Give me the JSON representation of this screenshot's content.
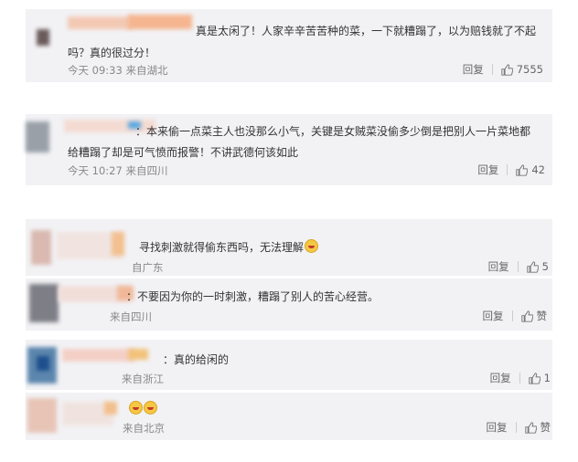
{
  "comments": [
    {
      "text_line1": "真是太闲了！人家辛辛苦苦种的菜，一下就糟蹋了，以为赔钱就了不起",
      "text_line2": "吗？真的很过分！",
      "meta": "今天 09:33 来自湖北",
      "reply": "回复",
      "likes": "7555"
    },
    {
      "text_line1": "：本来偷一点菜主人也没那么小气，关键是女贼菜没偷多少倒是把别人一片菜地都",
      "text_line2": "给糟蹋了却是可气愤而报警！不讲武德何该如此",
      "meta": "今天 10:27 来自四川",
      "reply": "回复",
      "likes": "42"
    },
    {
      "text": "寻找刺激就得偷东西吗，无法理解",
      "meta": "自广东",
      "reply": "回复",
      "likes": "5"
    },
    {
      "text": "：不要因为你的一时刺激，糟蹋了别人的苦心经营。",
      "meta": "来自四川",
      "reply": "回复",
      "likes": "赞"
    },
    {
      "text": "：真的给闲的",
      "meta": "来自浙江",
      "reply": "回复",
      "likes": "1"
    },
    {
      "meta": "来自北京",
      "reply": "回复",
      "likes": "赞"
    }
  ],
  "icons": {
    "like": "thumbs-up-icon"
  }
}
